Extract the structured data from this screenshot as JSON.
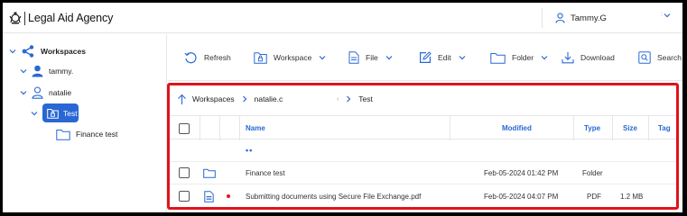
{
  "header": {
    "app_title": "Legal Aid Agency",
    "user_name": "Tammy.G"
  },
  "sidebar": {
    "root": "Workspaces",
    "user_node": "tammy.",
    "other_user": "natalie",
    "selected": "Test",
    "child": "Finance test"
  },
  "toolbar": {
    "refresh": "Refresh",
    "workspace": "Workspace",
    "file": "File",
    "edit": "Edit",
    "folder": "Folder",
    "download": "Download",
    "search": "Search"
  },
  "breadcrumb": {
    "root": "Workspaces",
    "user": "natalie.c",
    "current": "Test"
  },
  "table": {
    "columns": {
      "name": "Name",
      "modified": "Modified",
      "type": "Type",
      "size": "Size",
      "tag": "Tag"
    },
    "parent_row": "••",
    "rows": [
      {
        "name": "Finance test",
        "modified": "Feb-05-2024 01:42 PM",
        "type": "Folder",
        "size": ""
      },
      {
        "name": "Submitting documents using Secure File Exchange.pdf",
        "modified": "Feb-05-2024 04:07 PM",
        "type": "PDF",
        "size": "1.2 MB"
      }
    ]
  },
  "colors": {
    "accent": "#2968d4",
    "highlight_border": "#e0131b"
  }
}
